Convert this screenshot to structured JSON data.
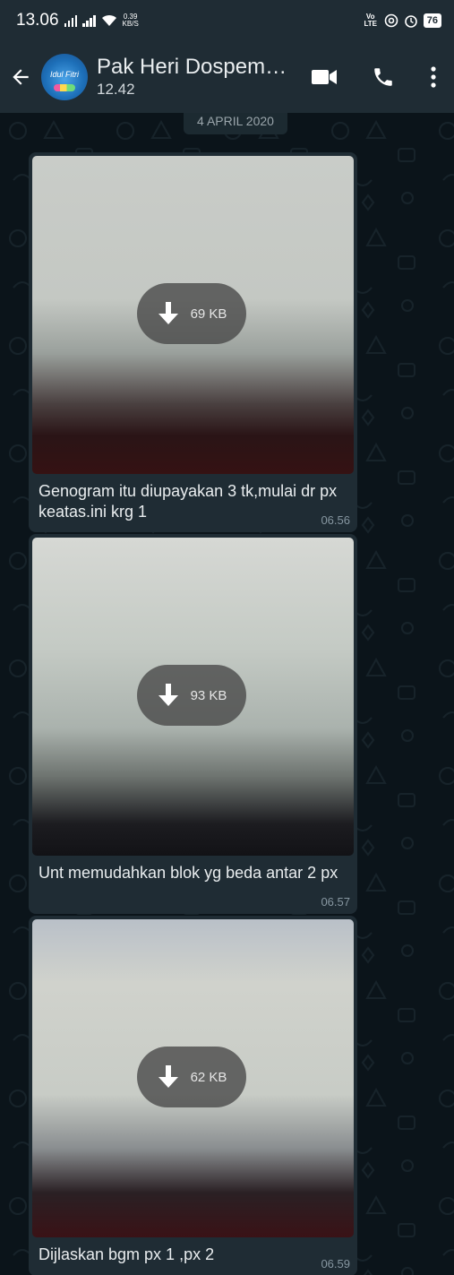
{
  "status_bar": {
    "time": "13.06",
    "net_speed_value": "0.39",
    "net_speed_unit": "KB/S",
    "volte_label": "Vo LTE",
    "battery": "76"
  },
  "header": {
    "contact_name": "Pak Heri Dospem…",
    "subtitle": "12.42",
    "avatar_text": "Idul Fitri"
  },
  "chat": {
    "date_chip": "4 APRIL 2020",
    "messages": [
      {
        "size": "69 KB",
        "caption": "Genogram itu diupayakan 3 tk,mulai dr px keatas.ini krg 1",
        "time": "06.56"
      },
      {
        "size": "93 KB",
        "caption": "Unt memudahkan blok yg beda antar 2 px",
        "time": "06.57"
      },
      {
        "size": "62 KB",
        "caption": "Dijlaskan bgm  px 1 ,px 2",
        "time": "06.59"
      }
    ]
  },
  "icons": {
    "back": "arrow-left-icon",
    "video": "video-call-icon",
    "call": "phone-icon",
    "menu": "more-vertical-icon",
    "download": "download-arrow-icon"
  },
  "colors": {
    "header_bg": "#1f2c34",
    "chat_bg": "#0b141a",
    "bubble_bg": "#1f2c34",
    "time_text": "#8696a0"
  }
}
